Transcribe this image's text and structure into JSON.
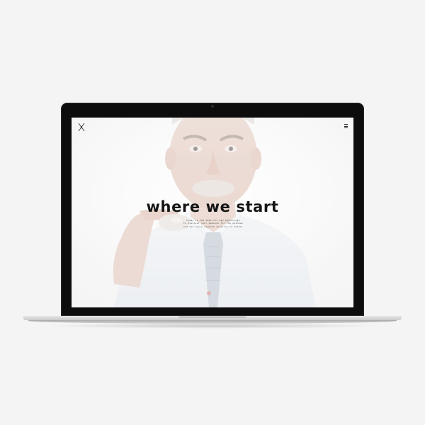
{
  "hero": {
    "title": "where we start",
    "subtitle_lines": [
      "today is the date for new beginnings",
      "to discover your passion for the unknown",
      "and let every element surprise in detail"
    ]
  },
  "icons": {
    "logo": "crossed-x-logo",
    "menu": "hamburger-menu-icon"
  },
  "colors": {
    "background": "#f4f4f4",
    "bezel": "#0d0d0d",
    "headline": "#151515"
  }
}
